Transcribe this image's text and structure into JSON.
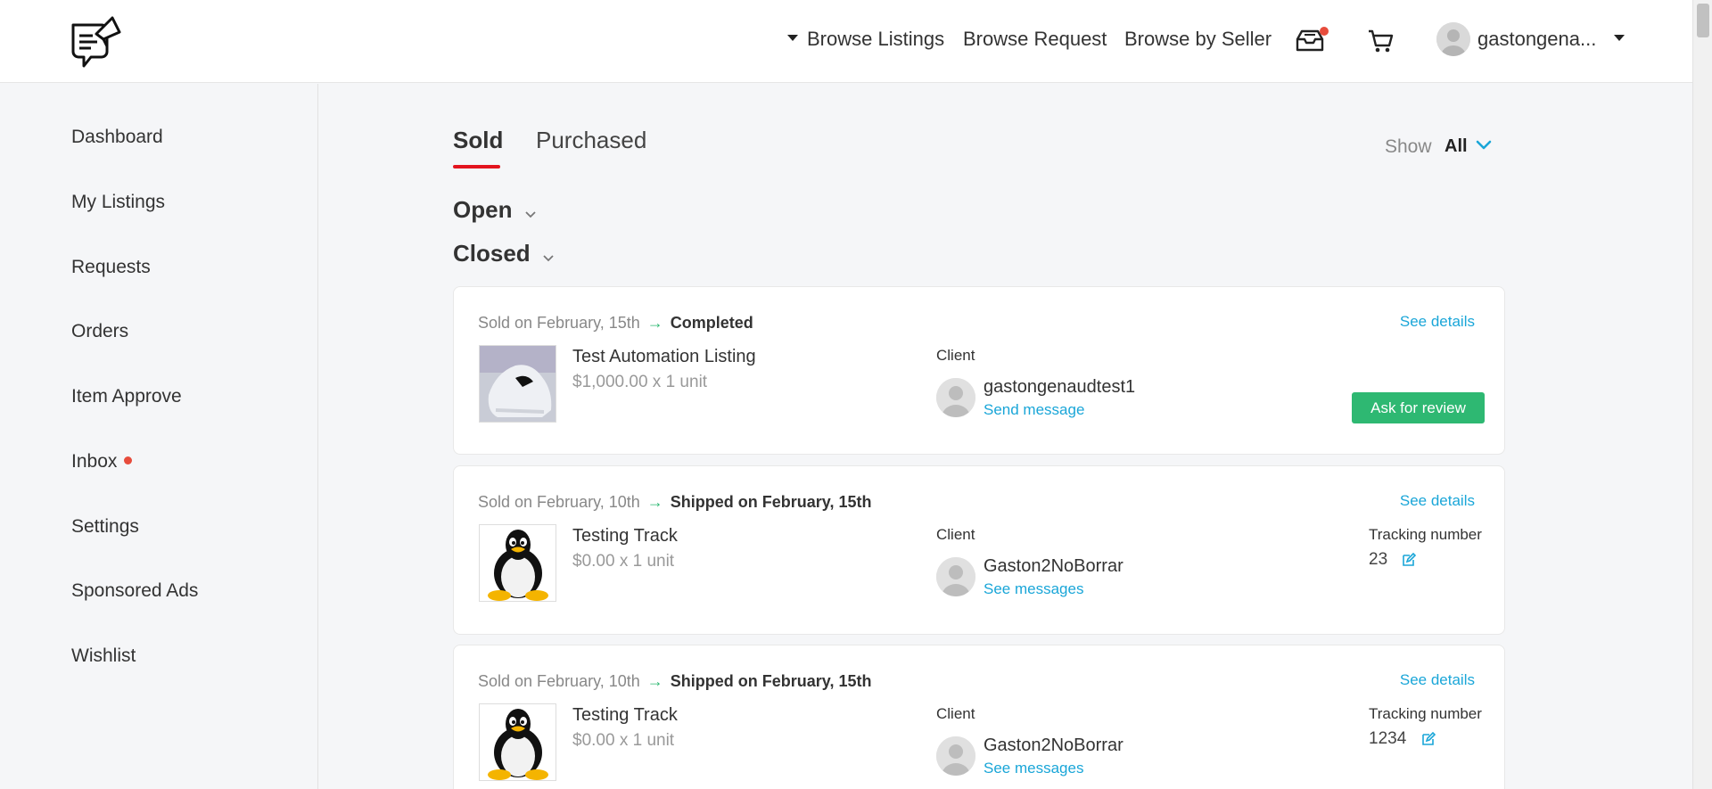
{
  "header": {
    "nav": {
      "browse_listings": "Browse Listings",
      "browse_request": "Browse Request",
      "browse_by_seller": "Browse by Seller"
    },
    "user_name": "gastongena..."
  },
  "sidebar": {
    "items": [
      {
        "label": "Dashboard"
      },
      {
        "label": "My Listings"
      },
      {
        "label": "Requests"
      },
      {
        "label": "Orders"
      },
      {
        "label": "Item Approve"
      },
      {
        "label": "Inbox"
      },
      {
        "label": "Settings"
      },
      {
        "label": "Sponsored Ads"
      },
      {
        "label": "Wishlist"
      }
    ]
  },
  "tabs": {
    "sold": "Sold",
    "purchased": "Purchased"
  },
  "filter": {
    "label": "Show",
    "value": "All"
  },
  "groups": {
    "open": "Open",
    "closed": "Closed"
  },
  "orders": [
    {
      "sold_on": "Sold on February, 15th",
      "status": "Completed",
      "see_details": "See details",
      "title": "Test Automation Listing",
      "price": "$1,000.00 x 1 unit",
      "client_label": "Client",
      "client_name": "gastongenaudtest1",
      "message_link": "Send message",
      "action": "Ask for review"
    },
    {
      "sold_on": "Sold on February, 10th",
      "status": "Shipped on February, 15th",
      "see_details": "See details",
      "title": "Testing Track",
      "price": "$0.00 x 1 unit",
      "client_label": "Client",
      "client_name": "Gaston2NoBorrar",
      "message_link": "See messages",
      "tracking_label": "Tracking number",
      "tracking_number": "23"
    },
    {
      "sold_on": "Sold on February, 10th",
      "status": "Shipped on February, 15th",
      "see_details": "See details",
      "title": "Testing Track",
      "price": "$0.00 x 1 unit",
      "client_label": "Client",
      "client_name": "Gaston2NoBorrar",
      "message_link": "See messages",
      "tracking_label": "Tracking number",
      "tracking_number": "1234"
    }
  ],
  "colors": {
    "accent_red": "#e3141e",
    "link_blue": "#1aa6d8",
    "success_green": "#2eb872"
  }
}
